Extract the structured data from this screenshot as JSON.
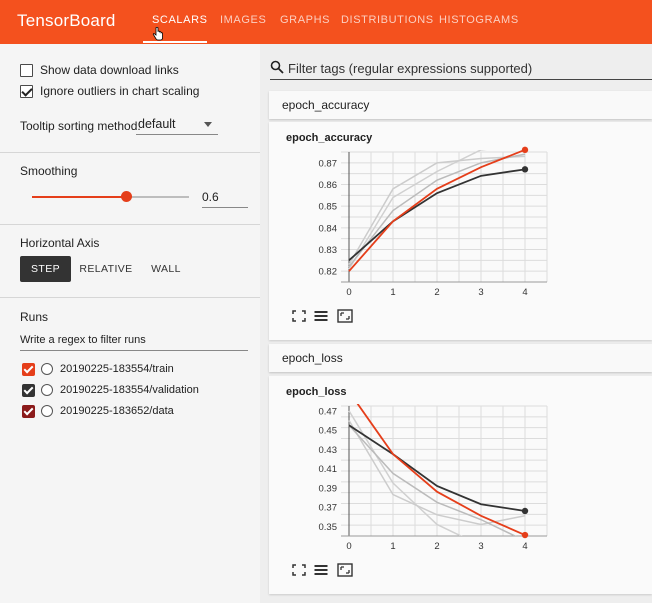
{
  "app": {
    "title": "TensorBoard",
    "tabs": [
      {
        "label": "SCALARS",
        "active": true
      },
      {
        "label": "IMAGES",
        "active": false
      },
      {
        "label": "GRAPHS",
        "active": false
      },
      {
        "label": "DISTRIBUTIONS",
        "active": false
      },
      {
        "label": "HISTOGRAMS",
        "active": false
      }
    ],
    "accent": "#f4511e"
  },
  "sidebar": {
    "show_download_label": "Show data download links",
    "show_download_checked": false,
    "ignore_outliers_label": "Ignore outliers in chart scaling",
    "ignore_outliers_checked": true,
    "tooltip_label": "Tooltip sorting method:",
    "tooltip_value": "default",
    "smoothing_title": "Smoothing",
    "smoothing_value": "0.6",
    "smoothing_fraction": 0.6,
    "haxis_title": "Horizontal Axis",
    "haxis_options": [
      "STEP",
      "RELATIVE",
      "WALL"
    ],
    "haxis_selected": "STEP",
    "runs_title": "Runs",
    "runs_filter_placeholder": "Write a regex to filter runs",
    "runs": [
      {
        "name": "20190225-183554/train",
        "color": "#e53e1a",
        "checked": true
      },
      {
        "name": "20190225-183554/validation",
        "color": "#333333",
        "checked": true
      },
      {
        "name": "20190225-183652/data",
        "color": "#8b1a1a",
        "checked": true
      }
    ]
  },
  "main": {
    "filter_placeholder": "Filter tags (regular expressions supported)",
    "groups": [
      {
        "header": "epoch_accuracy",
        "card_title": "epoch_accuracy"
      },
      {
        "header": "epoch_loss",
        "card_title": "epoch_loss"
      }
    ]
  },
  "chart_data": [
    {
      "type": "line",
      "title": "epoch_accuracy",
      "x": [
        0,
        1,
        2,
        3,
        4
      ],
      "xticks": [
        "0",
        "1",
        "2",
        "3",
        "4"
      ],
      "yticks": [
        "0.82",
        "0.83",
        "0.84",
        "0.85",
        "0.86",
        "0.87"
      ],
      "ylim": [
        0.815,
        0.875
      ],
      "grid": true,
      "series": [
        {
          "color": "#e53e1a",
          "values": [
            0.82,
            0.843,
            0.858,
            0.868,
            0.876
          ]
        },
        {
          "color": "#333333",
          "values": [
            0.825,
            0.843,
            0.856,
            0.864,
            0.867
          ]
        },
        {
          "color": "#bbbbbb",
          "values": [
            0.822,
            0.848,
            0.862,
            0.87,
            0.874
          ]
        },
        {
          "color": "#cccccc",
          "values": [
            0.823,
            0.858,
            0.87,
            0.872,
            0.873
          ]
        },
        {
          "color": "#d0d0d0",
          "values": [
            0.821,
            0.854,
            0.866,
            0.876,
            0.878
          ]
        }
      ]
    },
    {
      "type": "line",
      "title": "epoch_loss",
      "x": [
        0,
        1,
        2,
        3,
        4
      ],
      "xticks": [
        "0",
        "1",
        "2",
        "3",
        "4"
      ],
      "yticks": [
        "0.35",
        "0.37",
        "0.39",
        "0.41",
        "0.43",
        "0.45",
        "0.47"
      ],
      "ylim": [
        0.34,
        0.475
      ],
      "grid": true,
      "series": [
        {
          "color": "#e53e1a",
          "values": [
            0.49,
            0.425,
            0.386,
            0.361,
            0.341
          ]
        },
        {
          "color": "#333333",
          "values": [
            0.455,
            0.425,
            0.392,
            0.373,
            0.366
          ]
        },
        {
          "color": "#bbbbbb",
          "values": [
            0.455,
            0.405,
            0.375,
            0.357,
            0.335
          ]
        },
        {
          "color": "#cccccc",
          "values": [
            0.46,
            0.383,
            0.362,
            0.352,
            0.361
          ]
        },
        {
          "color": "#d0d0d0",
          "values": [
            0.47,
            0.395,
            0.352,
            0.33,
            0.32
          ]
        }
      ]
    }
  ]
}
